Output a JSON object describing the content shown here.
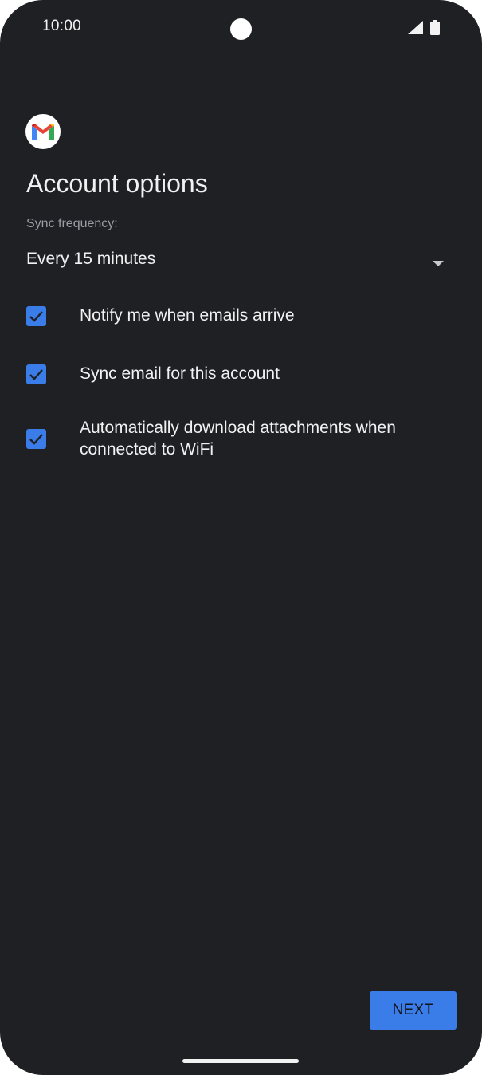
{
  "status_bar": {
    "time": "10:00",
    "icons": [
      "camera-cutout",
      "cellular-signal-icon",
      "battery-icon"
    ]
  },
  "header": {
    "logo": "gmail-logo",
    "title": "Account options"
  },
  "sync": {
    "label": "Sync frequency:",
    "selected": "Every 15 minutes",
    "arrow_icon": "dropdown-arrow-icon"
  },
  "options": [
    {
      "label": "Notify me when emails arrive",
      "checked": true
    },
    {
      "label": "Sync email for this account",
      "checked": true
    },
    {
      "label": "Automatically download attachments when connected to WiFi",
      "checked": true
    }
  ],
  "footer": {
    "next_label": "NEXT"
  },
  "colors": {
    "background": "#1f2024",
    "accent": "#3b7de8",
    "text": "#f1f1f3",
    "secondary_text": "#9c9da3"
  }
}
